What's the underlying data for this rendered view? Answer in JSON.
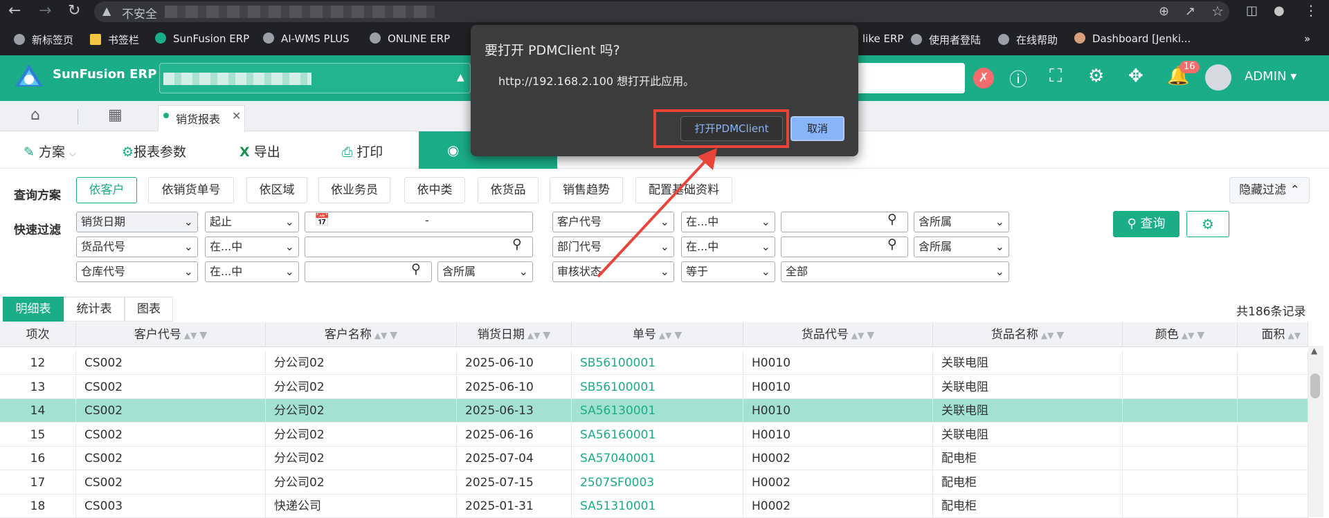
{
  "browser": {
    "insecure_label": "不安全",
    "bookmarks": [
      "新标签页",
      "书签栏",
      "SunFusion ERP",
      "AI-WMS PLUS",
      "ONLINE ERP",
      "like ERP",
      "使用者登陆",
      "在线帮助",
      "Dashboard [Jenki..."
    ]
  },
  "header": {
    "brand": "SunFusion ERP",
    "notification_count": "16",
    "user": "ADMIN"
  },
  "tabs": {
    "active_label": "销货报表"
  },
  "toolbar": {
    "plan": "方案",
    "params": "报表参数",
    "export": "导出",
    "print": "打印"
  },
  "filter": {
    "scheme_label": "查询方案",
    "quick_label": "快速过滤",
    "schemes": [
      "依客户",
      "依销货单号",
      "依区域",
      "依业务员",
      "依中类",
      "依货品",
      "销售趋势",
      "配置基础资料"
    ],
    "hide_label": "隐藏过滤",
    "row1": {
      "field": "销货日期",
      "op": "起止",
      "date_sep": "-",
      "field2": "客户代号",
      "op2": "在...中",
      "scope2": "含所属"
    },
    "row2": {
      "field": "货品代号",
      "op": "在...中",
      "field2": "部门代号",
      "op2": "在...中",
      "scope2": "含所属"
    },
    "row3": {
      "field": "仓库代号",
      "op": "在...中",
      "scope": "含所属",
      "field2": "审核状态",
      "op2": "等于",
      "value2": "全部"
    },
    "query_button": "查询"
  },
  "results": {
    "tabs": [
      "明细表",
      "统计表",
      "图表"
    ],
    "total": "共186条记录",
    "columns": [
      "项次",
      "客户代号",
      "客户名称",
      "销货日期",
      "单号",
      "货品代号",
      "货品名称",
      "颜色",
      "面积"
    ],
    "rows": [
      [
        "12",
        "CS002",
        "分公司02",
        "2025-06-10",
        "SB56100001",
        "H0010",
        "关联电阻",
        "",
        ""
      ],
      [
        "13",
        "CS002",
        "分公司02",
        "2025-06-10",
        "SB56100001",
        "H0010",
        "关联电阻",
        "",
        ""
      ],
      [
        "14",
        "CS002",
        "分公司02",
        "2025-06-13",
        "SA56130001",
        "H0010",
        "关联电阻",
        "",
        ""
      ],
      [
        "15",
        "CS002",
        "分公司02",
        "2025-06-16",
        "SA56160001",
        "H0010",
        "关联电阻",
        "",
        ""
      ],
      [
        "16",
        "CS002",
        "分公司02",
        "2025-07-04",
        "SA57040001",
        "H0002",
        "配电柜",
        "",
        ""
      ],
      [
        "17",
        "CS002",
        "分公司02",
        "2025-07-15",
        "2507SF0003",
        "H0002",
        "配电柜",
        "",
        ""
      ],
      [
        "18",
        "CS003",
        "快递公司",
        "2025-01-31",
        "SA51310001",
        "H0002",
        "配电柜",
        "",
        ""
      ]
    ],
    "highlighted_row": "14"
  },
  "dialog": {
    "title": "要打开 PDMClient 吗?",
    "message": "http://192.168.2.100 想打开此应用。",
    "open_button": "打开PDMClient",
    "cancel_button": "取消"
  },
  "colors": {
    "accent": "#1aad87",
    "highlight_row": "#a3e2d1",
    "annotation": "#e8443a"
  }
}
